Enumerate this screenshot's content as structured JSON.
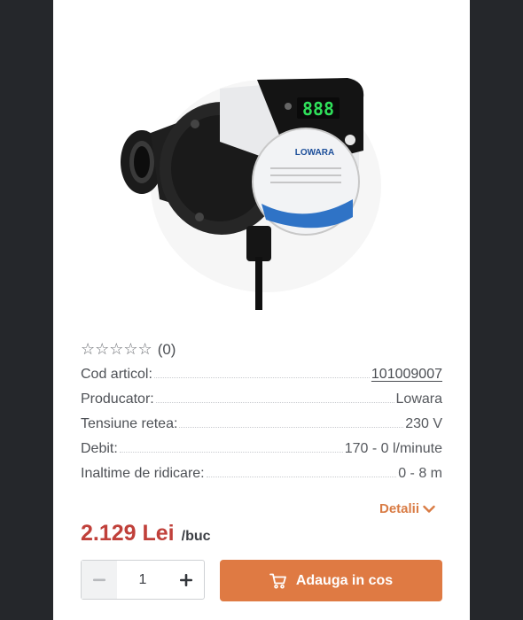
{
  "product": {
    "image_alt": "circulation pump",
    "brand_on_image": "LOWARA",
    "display_digits": "888"
  },
  "rating": {
    "stars_filled": 0,
    "stars_total": 5,
    "count_text": "(0)"
  },
  "specs": [
    {
      "label": "Cod articol:",
      "value": "101009007"
    },
    {
      "label": "Producator:",
      "value": "Lowara"
    },
    {
      "label": "Tensiune retea:",
      "value": "230 V"
    },
    {
      "label": "Debit:",
      "value": "170 - 0 l/minute"
    },
    {
      "label": "Inaltime de ridicare:",
      "value": "0 - 8 m"
    }
  ],
  "details_label": "Detalii",
  "price": {
    "amount": "2.129 Lei",
    "unit": "/buc"
  },
  "quantity": {
    "value": "1"
  },
  "add_to_cart_label": "Adauga in cos",
  "colors": {
    "accent": "#df7a43",
    "price": "#c0403a",
    "background": "#24262a"
  }
}
